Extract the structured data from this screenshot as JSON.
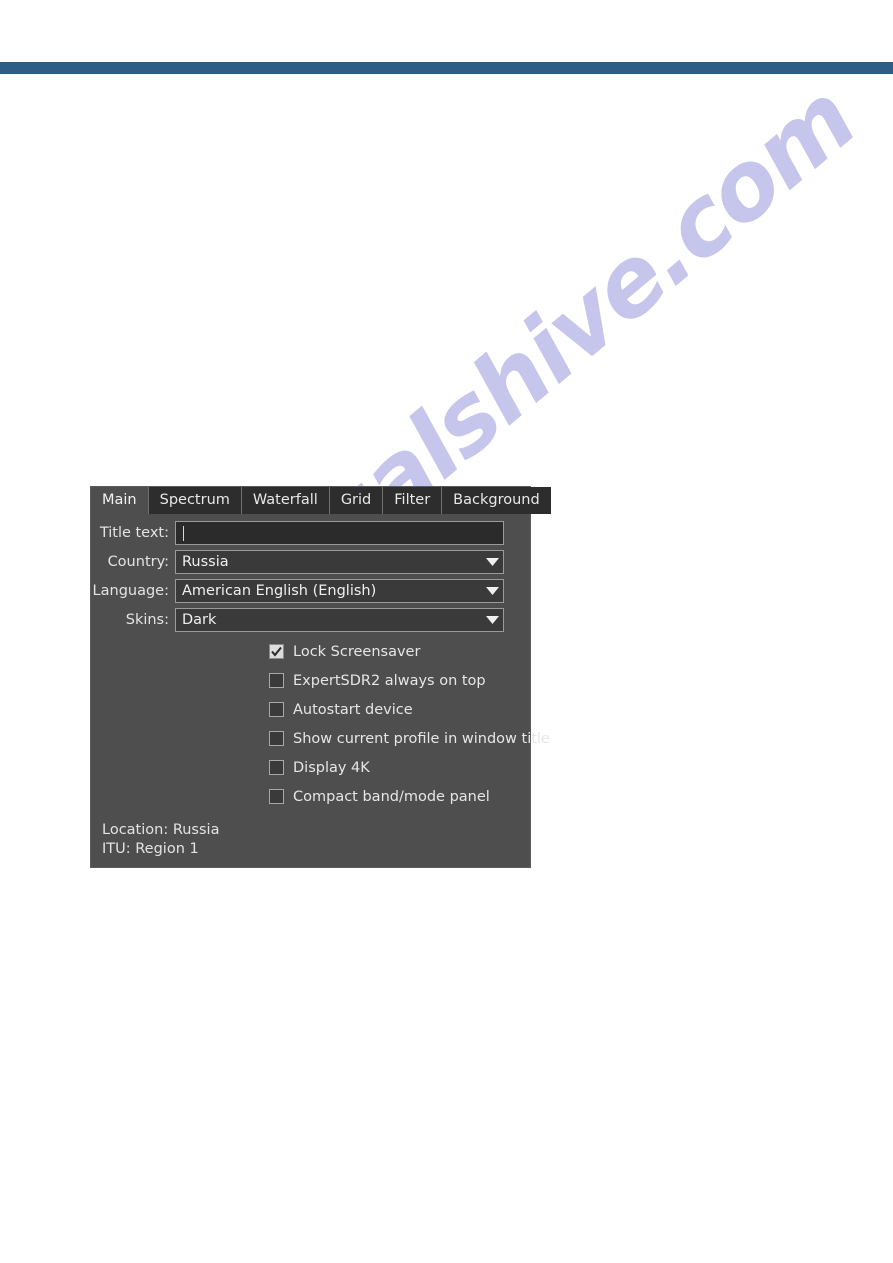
{
  "page": {
    "background_color": "#ffffff",
    "rule_color": "#2e5d85"
  },
  "watermark": {
    "text": "manualshive.com",
    "color": "#c6c5ec"
  },
  "dialog": {
    "panel_color": "#4e4e4e",
    "tabs": [
      {
        "label": "Main",
        "active": true
      },
      {
        "label": "Spectrum",
        "active": false
      },
      {
        "label": "Waterfall",
        "active": false
      },
      {
        "label": "Grid",
        "active": false
      },
      {
        "label": "Filter",
        "active": false
      },
      {
        "label": "Background",
        "active": false
      }
    ],
    "fields": {
      "title_text": {
        "label": "Title text:",
        "value": "",
        "placeholder": ""
      },
      "country": {
        "label": "Country:",
        "value": "Russia"
      },
      "language": {
        "label": "Language:",
        "value": "American English (English)"
      },
      "skins": {
        "label": "Skins:",
        "value": "Dark"
      }
    },
    "checkboxes": [
      {
        "label": "Lock Screensaver",
        "checked": true
      },
      {
        "label": "ExpertSDR2 always on top",
        "checked": false
      },
      {
        "label": "Autostart device",
        "checked": false
      },
      {
        "label": "Show current profile in window title",
        "checked": false
      },
      {
        "label": "Display 4K",
        "checked": false
      },
      {
        "label": "Compact band/mode panel",
        "checked": false
      }
    ],
    "footer": {
      "location": "Location: Russia",
      "itu": "ITU: Region 1"
    }
  }
}
